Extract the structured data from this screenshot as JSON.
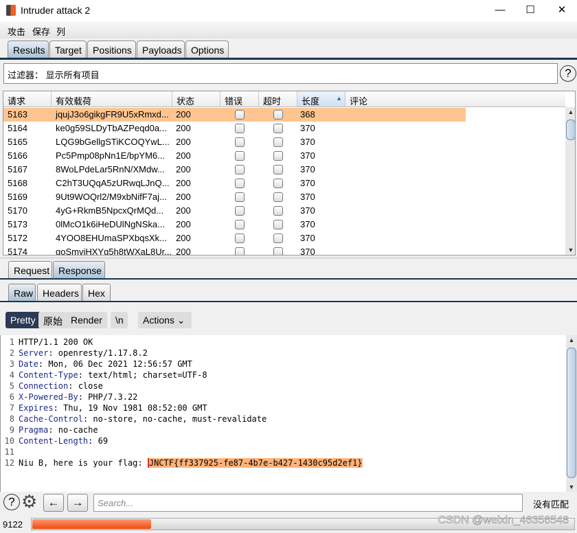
{
  "window": {
    "title": "Intruder attack 2",
    "minimize": "—",
    "maximize": "☐",
    "close": "✕"
  },
  "menu": [
    "攻击",
    "保存",
    "列"
  ],
  "tabs": [
    "Results",
    "Target",
    "Positions",
    "Payloads",
    "Options"
  ],
  "active_tab": "Results",
  "filter": {
    "text": "过滤器： 显示所有项目",
    "help": "?"
  },
  "table": {
    "columns": [
      "请求",
      "有效载荷",
      "状态",
      "错误",
      "超时",
      "长度",
      "评论"
    ],
    "sorted_column": "长度",
    "sort_arrow": "▲",
    "rows": [
      {
        "req": "5163",
        "payload": "jqujJ3o6gikgFR9U5xRmxd...",
        "status": "200",
        "error": false,
        "timeout": false,
        "length": "368",
        "comment": "",
        "selected": true
      },
      {
        "req": "5164",
        "payload": "ke0g59SLDyTbAZPeqd0a...",
        "status": "200",
        "error": false,
        "timeout": false,
        "length": "370",
        "comment": ""
      },
      {
        "req": "5165",
        "payload": "LQG9bGellgSTiKCOQYwL...",
        "status": "200",
        "error": false,
        "timeout": false,
        "length": "370",
        "comment": ""
      },
      {
        "req": "5166",
        "payload": "Pc5Pmp08pNn1E/bpYM6...",
        "status": "200",
        "error": false,
        "timeout": false,
        "length": "370",
        "comment": ""
      },
      {
        "req": "5167",
        "payload": "8WoLPdeLar5RnN/XMdw...",
        "status": "200",
        "error": false,
        "timeout": false,
        "length": "370",
        "comment": ""
      },
      {
        "req": "5168",
        "payload": "C2hT3UQqA5zURwqLJnQ...",
        "status": "200",
        "error": false,
        "timeout": false,
        "length": "370",
        "comment": ""
      },
      {
        "req": "5169",
        "payload": "9Ut9WOQrl2/M9xbNifF7aj...",
        "status": "200",
        "error": false,
        "timeout": false,
        "length": "370",
        "comment": ""
      },
      {
        "req": "5170",
        "payload": "4yG+RkmB5NpcxQrMQd...",
        "status": "200",
        "error": false,
        "timeout": false,
        "length": "370",
        "comment": ""
      },
      {
        "req": "5173",
        "payload": "0lMcO1k6iHeDUlNgNSka...",
        "status": "200",
        "error": false,
        "timeout": false,
        "length": "370",
        "comment": ""
      },
      {
        "req": "5172",
        "payload": "4YOO8EHUmaSPXbqsXk...",
        "status": "200",
        "error": false,
        "timeout": false,
        "length": "370",
        "comment": ""
      },
      {
        "req": "5174",
        "payload": "goSmvjHXYg5h8tWXaL8Ur...",
        "status": "200",
        "error": false,
        "timeout": false,
        "length": "370",
        "comment": ""
      }
    ]
  },
  "message_tabs": [
    "Request",
    "Response"
  ],
  "view_tabs": [
    "Raw",
    "Headers",
    "Hex"
  ],
  "toolbar": {
    "pretty": "Pretty",
    "raw": "原始",
    "render": "Render",
    "newline": "\\n",
    "actions": "Actions ⌄"
  },
  "response_lines": [
    {
      "n": "1",
      "key": "",
      "val": "HTTP/1.1 200 OK"
    },
    {
      "n": "2",
      "key": "Server",
      "val": ": openresty/1.17.8.2"
    },
    {
      "n": "3",
      "key": "Date",
      "val": ": Mon, 06 Dec 2021 12:56:57 GMT"
    },
    {
      "n": "4",
      "key": "Content-Type",
      "val": ": text/html; charset=UTF-8"
    },
    {
      "n": "5",
      "key": "Connection",
      "val": ": close"
    },
    {
      "n": "6",
      "key": "X-Powered-By",
      "val": ": PHP/7.3.22"
    },
    {
      "n": "7",
      "key": "Expires",
      "val": ": Thu, 19 Nov 1981 08:52:00 GMT"
    },
    {
      "n": "8",
      "key": "Cache-Control",
      "val": ": no-store, no-cache, must-revalidate"
    },
    {
      "n": "9",
      "key": "Pragma",
      "val": ": no-cache"
    },
    {
      "n": "10",
      "key": "Content-Length",
      "val": ": 69"
    },
    {
      "n": "11",
      "key": "",
      "val": ""
    },
    {
      "n": "12",
      "key": "",
      "val": "Niu B, here is your flag: ",
      "flag": "JNCTF{ff337925-fe87-4b7e-b427-1430c95d2ef1}"
    }
  ],
  "bottom": {
    "help": "?",
    "gear": "⚙",
    "prev": "←",
    "next": "→",
    "search_placeholder": "Search...",
    "match_status": "没有匹配"
  },
  "status": {
    "count": "9122",
    "progress_percent": 22
  },
  "watermark": "CSDN @weixin_46356548",
  "colors": {
    "selected_row": "#ffc590",
    "flag_highlight": "#ffb27a",
    "progress": "#f04a10",
    "header_key": "#1a2a8a"
  }
}
